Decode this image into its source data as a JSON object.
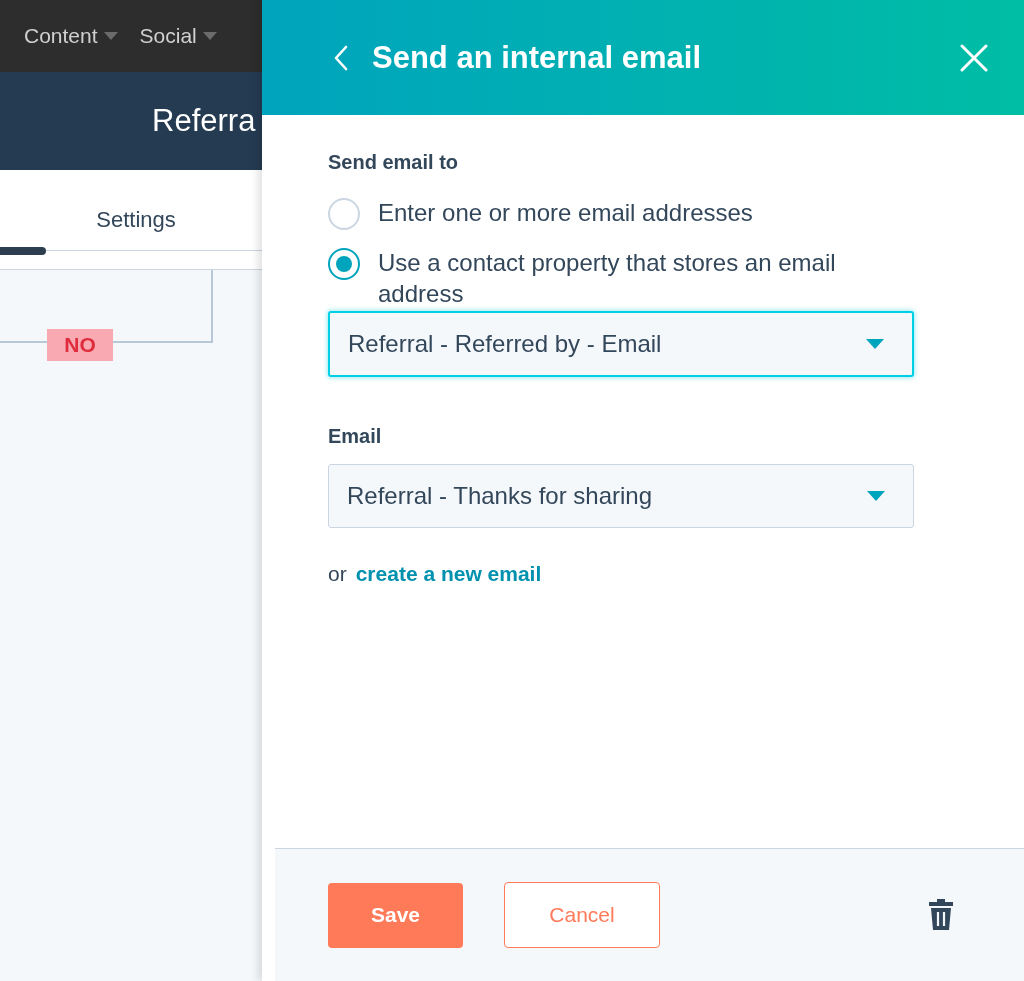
{
  "top_nav": {
    "items": [
      {
        "label": "Content"
      },
      {
        "label": "Social"
      }
    ]
  },
  "page_header": {
    "title": "Referra"
  },
  "tabs": [
    {
      "label": "Settings",
      "selected": false
    }
  ],
  "canvas": {
    "branch_label": "NO"
  },
  "panel": {
    "title": "Send an internal email",
    "send_to": {
      "label": "Send email to",
      "options": [
        {
          "label": "Enter one or more email addresses",
          "selected": false
        },
        {
          "label": "Use a contact property that stores an email address",
          "selected": true
        }
      ],
      "dropdown": {
        "value": "Referral - Referred by - Email",
        "focused": true
      }
    },
    "email": {
      "label": "Email",
      "dropdown": {
        "value": "Referral - Thanks for sharing",
        "focused": false
      },
      "alt_prefix": "or",
      "alt_link": "create a new email"
    },
    "footer": {
      "save": "Save",
      "cancel": "Cancel"
    }
  }
}
